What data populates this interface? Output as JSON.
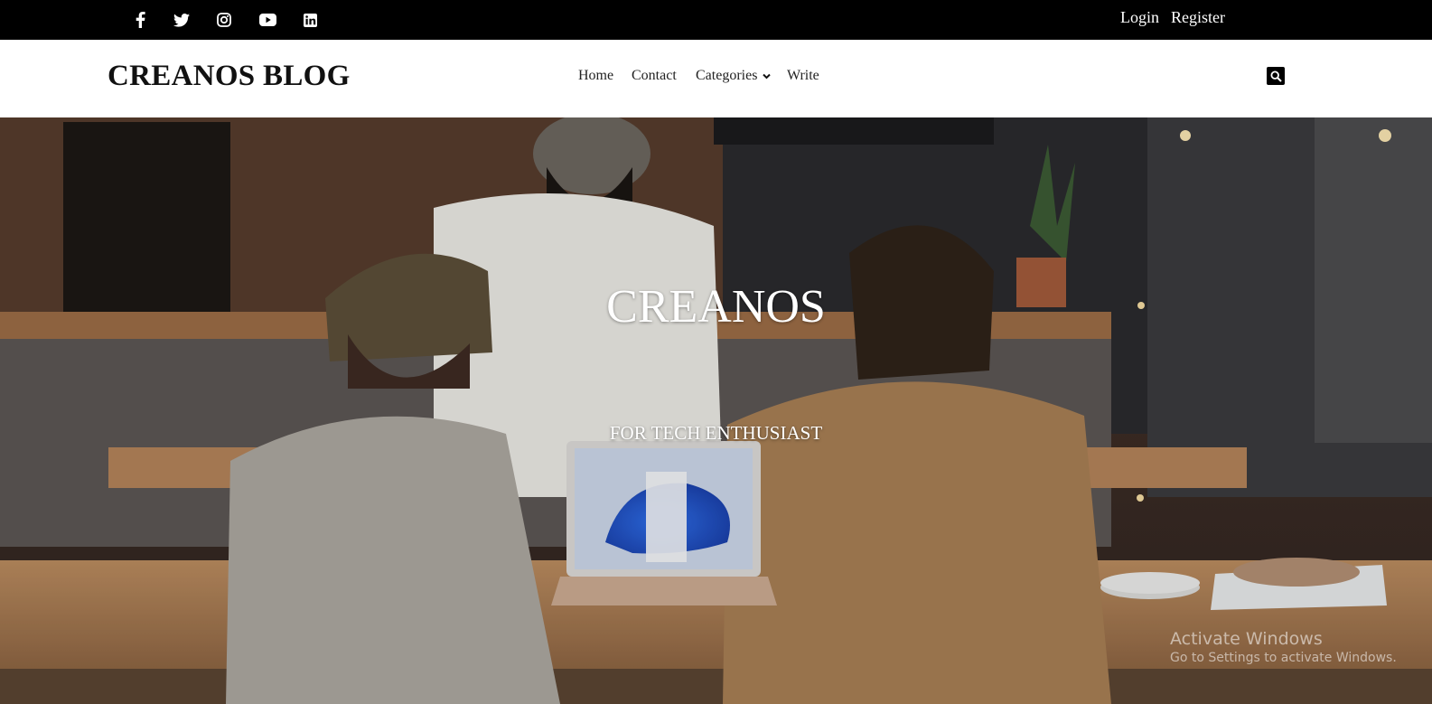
{
  "topbar": {
    "social_icons": [
      "facebook-icon",
      "twitter-icon",
      "instagram-icon",
      "youtube-icon",
      "linkedin-icon"
    ],
    "login_label": "Login",
    "register_label": "Register"
  },
  "header": {
    "logo": "CREANOS BLOG",
    "nav": {
      "home": "Home",
      "contact": "Contact",
      "categories": "Categories",
      "write": "Write"
    },
    "search_icon": "search-icon"
  },
  "hero": {
    "title": "CREANOS",
    "subtitle": "FOR TECH ENTHUSIAST"
  },
  "watermark": {
    "title": "Activate Windows",
    "subtitle": "Go to Settings to activate Windows."
  },
  "colors": {
    "topbar_bg": "#000000",
    "header_bg": "#ffffff",
    "text_dark": "#111111"
  }
}
